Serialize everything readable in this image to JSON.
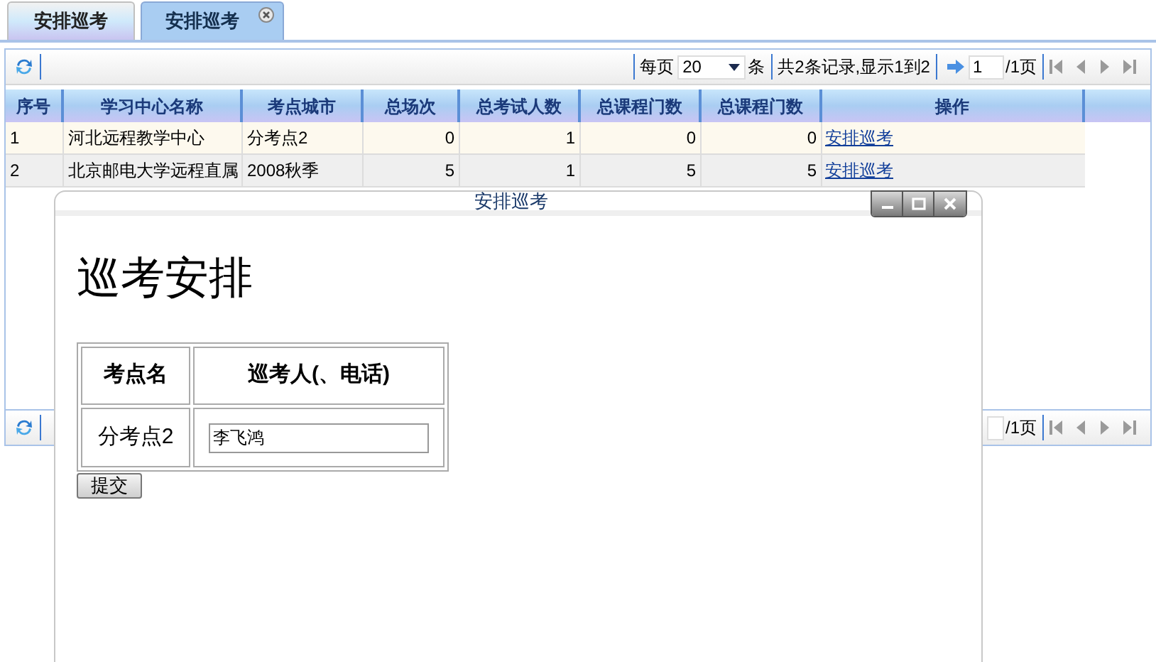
{
  "tabs": [
    {
      "label": "安排巡考",
      "selected": false,
      "closable": false
    },
    {
      "label": "安排巡考",
      "selected": true,
      "closable": true
    }
  ],
  "toolbar": {
    "per_page_label": "每页",
    "per_page": "20",
    "per_page_unit": "条",
    "record_info": "共2条记录,显示1到2",
    "page": "1",
    "page_total": "/1页"
  },
  "table": {
    "columns": [
      "序号",
      "学习中心名称",
      "考点城市",
      "总场次",
      "总考试人数",
      "总课程门数",
      "总课程门数",
      "操作"
    ],
    "rows": [
      {
        "cells": [
          "1",
          "河北远程教学中心",
          "分考点2",
          "0",
          "1",
          "0",
          "0"
        ],
        "action": "安排巡考",
        "selected": true
      },
      {
        "cells": [
          "2",
          "北京邮电大学远程直属",
          "2008秋季",
          "5",
          "1",
          "5",
          "5"
        ],
        "action": "安排巡考",
        "selected": false
      }
    ]
  },
  "bottom_toolbar": {
    "page_total": "/1页"
  },
  "dialog": {
    "title": "安排巡考",
    "heading": "巡考安排",
    "columns": [
      "考点名",
      "巡考人(、电话)"
    ],
    "rows": [
      {
        "site": "分考点2",
        "value": "李飞鸿"
      }
    ],
    "submit": "提交"
  }
}
